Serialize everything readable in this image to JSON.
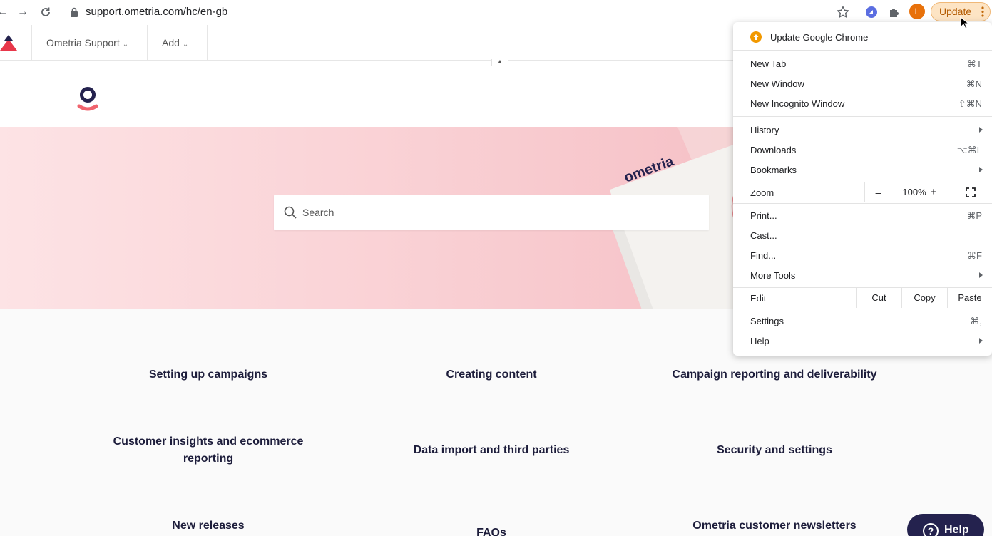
{
  "browser": {
    "url": "support.ometria.com/hc/en-gb",
    "avatar_letter": "L",
    "update_label": "Update"
  },
  "site_nav": {
    "items": [
      {
        "label": "Ometria Support"
      },
      {
        "label": "Add"
      }
    ]
  },
  "hero": {
    "search_placeholder": "Search"
  },
  "categories": [
    {
      "label": "Setting up campaigns"
    },
    {
      "label": "Creating content"
    },
    {
      "label": "Campaign reporting and deliverability"
    },
    {
      "label": "Customer insights and ecommerce reporting"
    },
    {
      "label": "Data import and third parties"
    },
    {
      "label": "Security and settings"
    },
    {
      "label": "New releases"
    },
    {
      "label": "FAQs"
    },
    {
      "label": "Ometria customer newsletters"
    }
  ],
  "help_button": {
    "label": "Help"
  },
  "chrome_menu": {
    "update_label": "Update Google Chrome",
    "items": {
      "new_tab": {
        "label": "New Tab",
        "shortcut": "⌘T"
      },
      "new_window": {
        "label": "New Window",
        "shortcut": "⌘N"
      },
      "new_incognito": {
        "label": "New Incognito Window",
        "shortcut": "⇧⌘N"
      },
      "history": {
        "label": "History"
      },
      "downloads": {
        "label": "Downloads",
        "shortcut": "⌥⌘L"
      },
      "bookmarks": {
        "label": "Bookmarks"
      },
      "print": {
        "label": "Print...",
        "shortcut": "⌘P"
      },
      "cast": {
        "label": "Cast..."
      },
      "find": {
        "label": "Find...",
        "shortcut": "⌘F"
      },
      "more_tools": {
        "label": "More Tools"
      },
      "settings": {
        "label": "Settings",
        "shortcut": "⌘,"
      },
      "help": {
        "label": "Help"
      }
    },
    "zoom": {
      "label": "Zoom",
      "minus": "–",
      "level": "100%",
      "plus": "+"
    },
    "edit": {
      "label": "Edit",
      "cut": "Cut",
      "copy": "Copy",
      "paste": "Paste"
    }
  },
  "colors": {
    "brand_navy": "#24224e",
    "brand_coral": "#f0646e",
    "update_orange": "#f29900"
  }
}
